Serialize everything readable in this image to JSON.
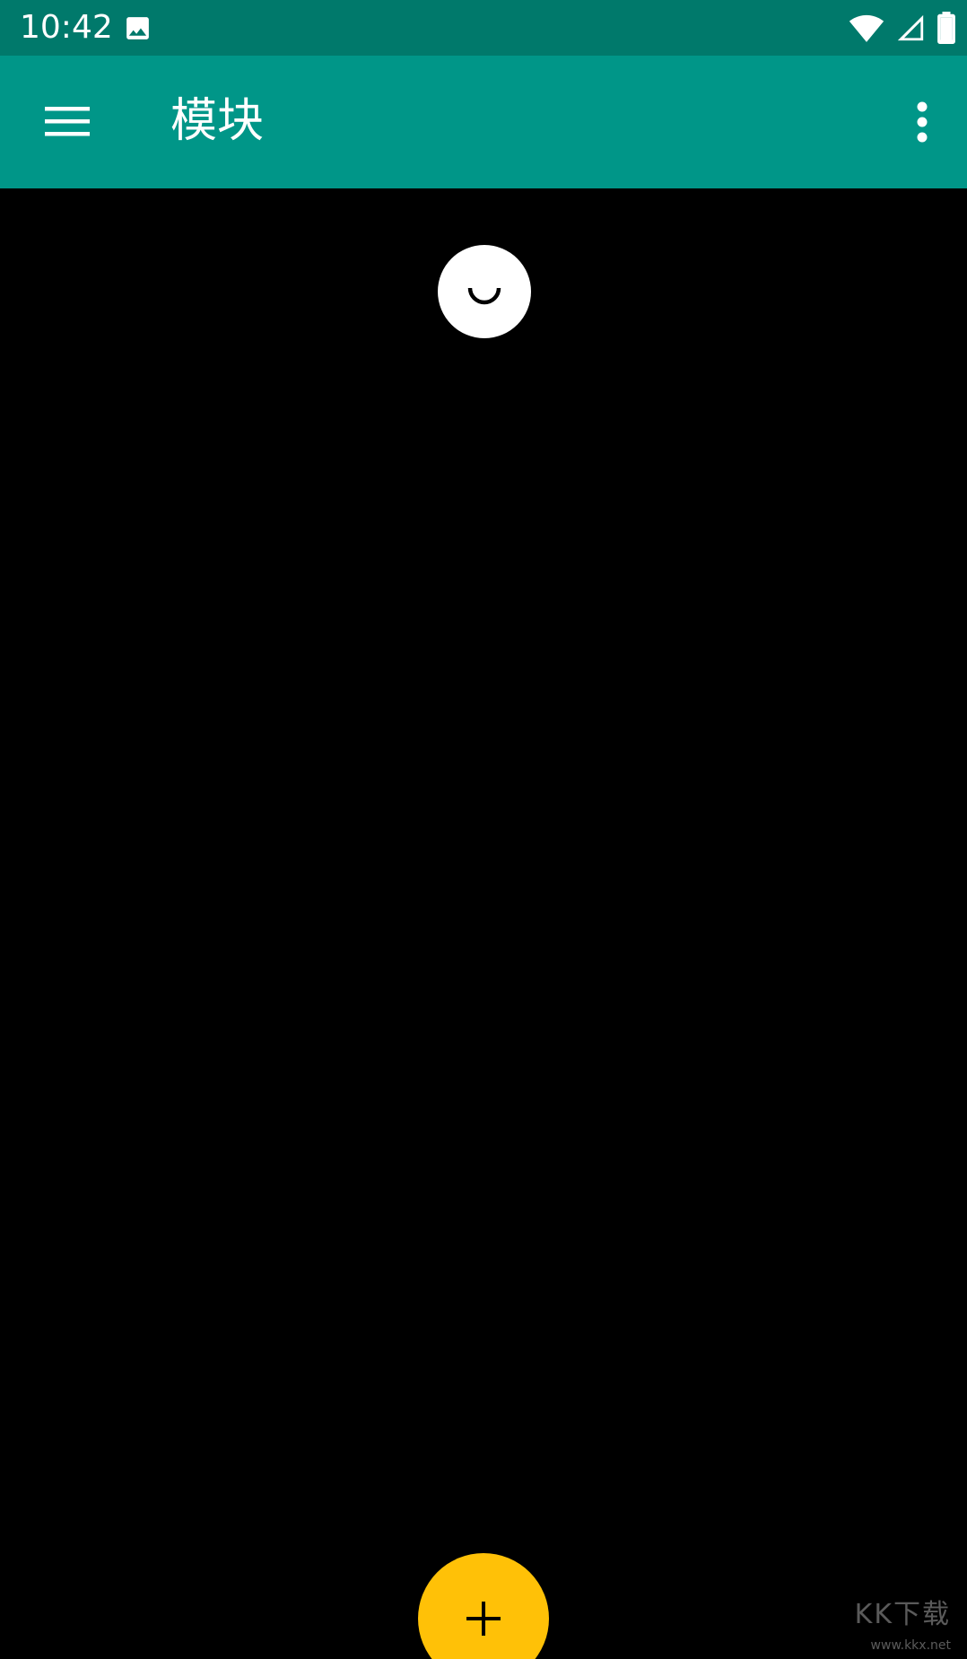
{
  "status_bar": {
    "time": "10:42",
    "icons": [
      "image-icon",
      "wifi-icon",
      "cell-signal-icon",
      "battery-icon"
    ]
  },
  "app_bar": {
    "title": "模块",
    "nav_icon": "menu-icon",
    "overflow_icon": "more-vert-icon"
  },
  "content": {
    "loading_indicator": "refresh-icon"
  },
  "fab": {
    "icon": "add-icon"
  },
  "watermark": {
    "logo": "KK下载",
    "url": "www.kkx.net"
  },
  "colors": {
    "status_bar": "#00796B",
    "app_bar": "#009688",
    "background": "#000000",
    "fab": "#FFC107"
  }
}
